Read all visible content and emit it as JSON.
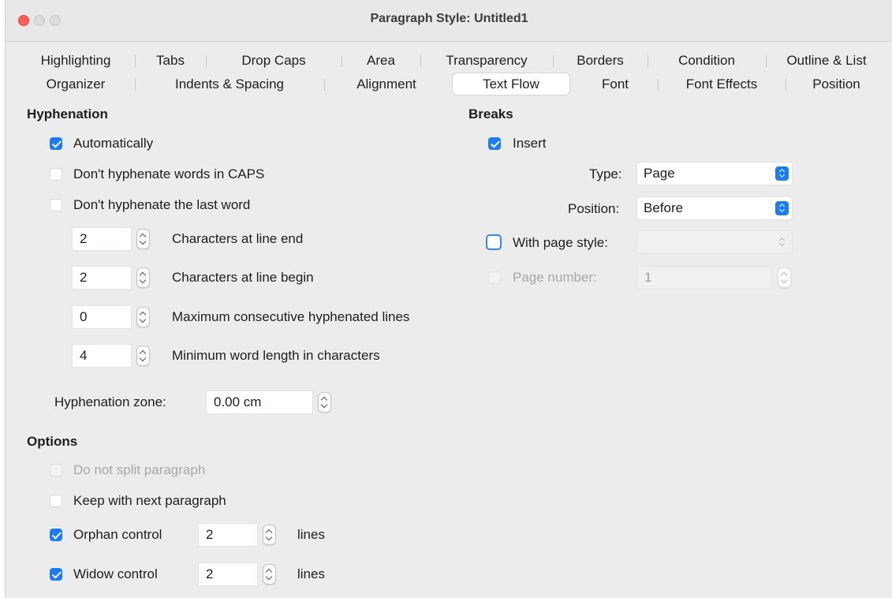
{
  "window": {
    "title": "Paragraph Style: Untitled1"
  },
  "tabs_row1": [
    "Highlighting",
    "Tabs",
    "Drop Caps",
    "Area",
    "Transparency",
    "Borders",
    "Condition",
    "Outline & List"
  ],
  "tabs_row2": [
    "Organizer",
    "Indents & Spacing",
    "Alignment",
    "Text Flow",
    "Font",
    "Font Effects",
    "Position"
  ],
  "active_tab": "Text Flow",
  "hyphenation": {
    "heading": "Hyphenation",
    "automatically": {
      "label": "Automatically",
      "checked": true
    },
    "no_caps": {
      "label": "Don't hyphenate words in CAPS",
      "checked": false
    },
    "no_last_word": {
      "label": "Don't hyphenate the last word",
      "checked": false
    },
    "chars_line_end": {
      "value": "2",
      "label": "Characters at line end"
    },
    "chars_line_begin": {
      "value": "2",
      "label": "Characters at line begin"
    },
    "max_consecutive": {
      "value": "0",
      "label": "Maximum consecutive hyphenated lines"
    },
    "min_word_length": {
      "value": "4",
      "label": "Minimum word length in characters"
    },
    "zone": {
      "label": "Hyphenation zone:",
      "value": "0.00 cm"
    }
  },
  "options": {
    "heading": "Options",
    "do_not_split": {
      "label": "Do not split paragraph",
      "checked": false,
      "disabled": true
    },
    "keep_with_next": {
      "label": "Keep with next paragraph",
      "checked": false
    },
    "orphan": {
      "label": "Orphan control",
      "checked": true,
      "value": "2",
      "unit": "lines"
    },
    "widow": {
      "label": "Widow control",
      "checked": true,
      "value": "2",
      "unit": "lines"
    }
  },
  "breaks": {
    "heading": "Breaks",
    "insert": {
      "label": "Insert",
      "checked": true
    },
    "type": {
      "label": "Type:",
      "value": "Page"
    },
    "position": {
      "label": "Position:",
      "value": "Before"
    },
    "with_page_style": {
      "label": "With page style:",
      "checked": false,
      "value": ""
    },
    "page_number": {
      "label": "Page number:",
      "value": "1",
      "disabled": true
    }
  },
  "colors": {
    "accent": "#1b7cf4",
    "close": "#fe5f57",
    "window_bg": "#ececec"
  }
}
